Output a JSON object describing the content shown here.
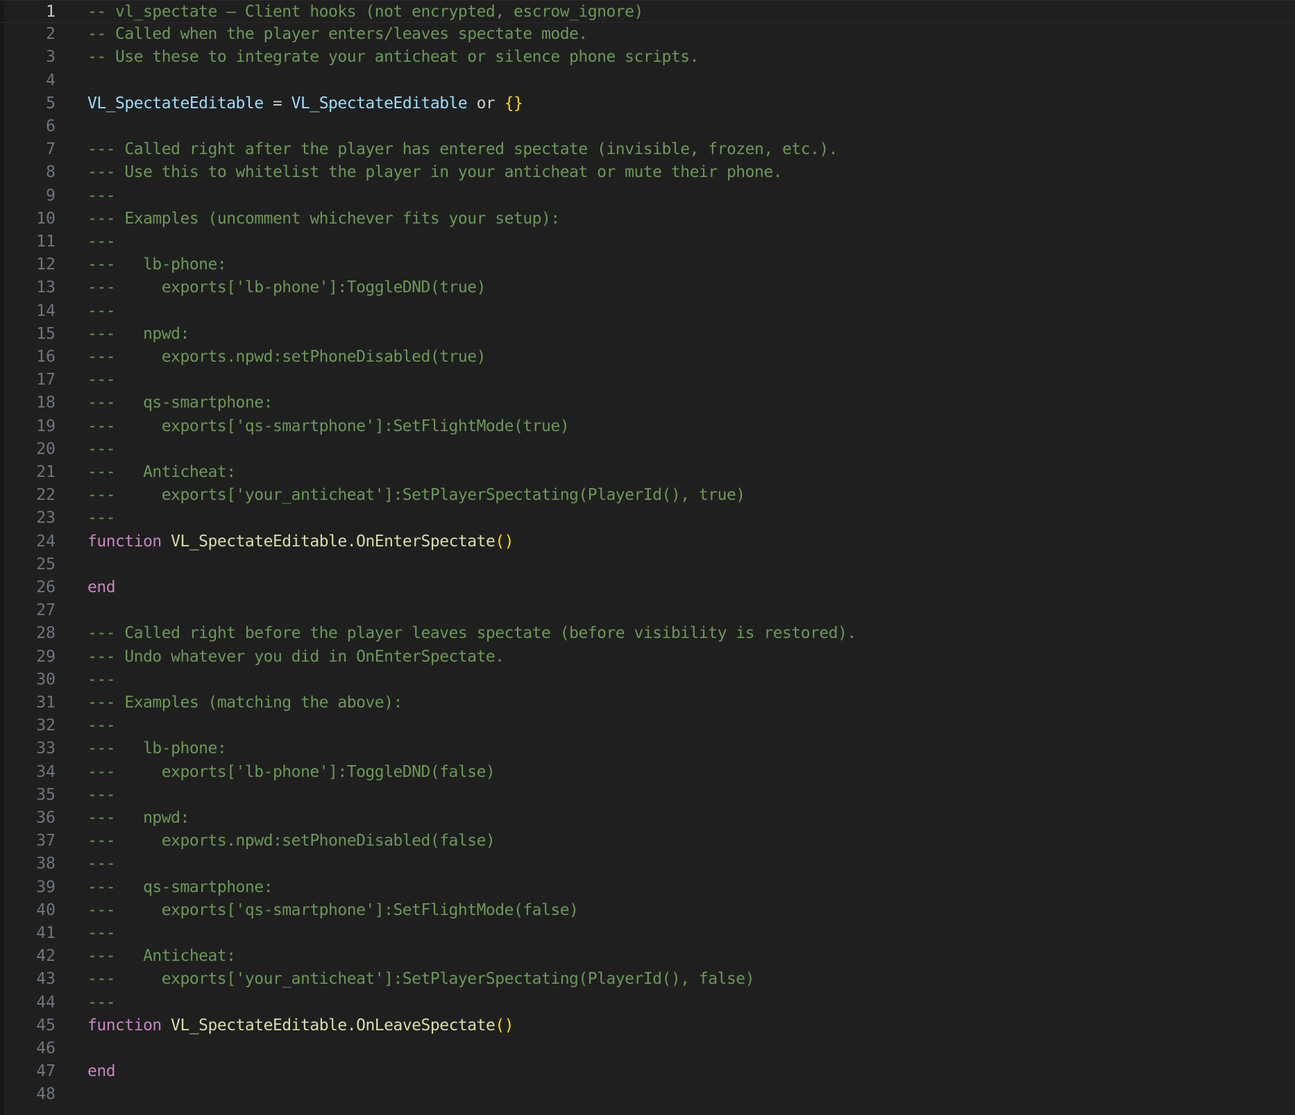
{
  "editor": {
    "language": "lua",
    "current_line": 1,
    "colors": {
      "background": "#1f1f1f",
      "line_number": "#6e7681",
      "line_number_active": "#cccccc",
      "comment": "#6a9955",
      "variable": "#9cdcfe",
      "keyword": "#c586c0",
      "function": "#dcdcaa",
      "brace": "#ffd700",
      "plain": "#cccccc"
    },
    "lines": [
      {
        "n": "1",
        "tokens": [
          {
            "t": "-- vl_spectate — Client hooks (not encrypted, escrow_ignore)",
            "c": "comment"
          }
        ]
      },
      {
        "n": "2",
        "tokens": [
          {
            "t": "-- Called when the player enters/leaves spectate mode.",
            "c": "comment"
          }
        ]
      },
      {
        "n": "3",
        "tokens": [
          {
            "t": "-- Use these to integrate your anticheat or silence phone scripts.",
            "c": "comment"
          }
        ]
      },
      {
        "n": "4",
        "tokens": []
      },
      {
        "n": "5",
        "tokens": [
          {
            "t": "VL_SpectateEditable",
            "c": "var"
          },
          {
            "t": " = ",
            "c": "plain"
          },
          {
            "t": "VL_SpectateEditable",
            "c": "var"
          },
          {
            "t": " ",
            "c": "plain"
          },
          {
            "t": "or",
            "c": "plain"
          },
          {
            "t": " ",
            "c": "plain"
          },
          {
            "t": "{}",
            "c": "brace"
          }
        ]
      },
      {
        "n": "6",
        "tokens": []
      },
      {
        "n": "7",
        "tokens": [
          {
            "t": "--- Called right after the player has entered spectate (invisible, frozen, etc.).",
            "c": "comment"
          }
        ]
      },
      {
        "n": "8",
        "tokens": [
          {
            "t": "--- Use this to whitelist the player in your anticheat or mute their phone.",
            "c": "comment"
          }
        ]
      },
      {
        "n": "9",
        "tokens": [
          {
            "t": "---",
            "c": "comment"
          }
        ]
      },
      {
        "n": "10",
        "tokens": [
          {
            "t": "--- Examples (uncomment whichever fits your setup):",
            "c": "comment"
          }
        ]
      },
      {
        "n": "11",
        "tokens": [
          {
            "t": "---",
            "c": "comment"
          }
        ]
      },
      {
        "n": "12",
        "tokens": [
          {
            "t": "---   lb-phone:",
            "c": "comment"
          }
        ]
      },
      {
        "n": "13",
        "tokens": [
          {
            "t": "---     exports['lb-phone']:ToggleDND(true)",
            "c": "comment"
          }
        ]
      },
      {
        "n": "14",
        "tokens": [
          {
            "t": "---",
            "c": "comment"
          }
        ]
      },
      {
        "n": "15",
        "tokens": [
          {
            "t": "---   npwd:",
            "c": "comment"
          }
        ]
      },
      {
        "n": "16",
        "tokens": [
          {
            "t": "---     exports.npwd:setPhoneDisabled(true)",
            "c": "comment"
          }
        ]
      },
      {
        "n": "17",
        "tokens": [
          {
            "t": "---",
            "c": "comment"
          }
        ]
      },
      {
        "n": "18",
        "tokens": [
          {
            "t": "---   qs-smartphone:",
            "c": "comment"
          }
        ]
      },
      {
        "n": "19",
        "tokens": [
          {
            "t": "---     exports['qs-smartphone']:SetFlightMode(true)",
            "c": "comment"
          }
        ]
      },
      {
        "n": "20",
        "tokens": [
          {
            "t": "---",
            "c": "comment"
          }
        ]
      },
      {
        "n": "21",
        "tokens": [
          {
            "t": "---   Anticheat:",
            "c": "comment"
          }
        ]
      },
      {
        "n": "22",
        "tokens": [
          {
            "t": "---     exports['your_anticheat']:SetPlayerSpectating(PlayerId(), true)",
            "c": "comment"
          }
        ]
      },
      {
        "n": "23",
        "tokens": [
          {
            "t": "---",
            "c": "comment"
          }
        ]
      },
      {
        "n": "24",
        "tokens": [
          {
            "t": "function",
            "c": "kw"
          },
          {
            "t": " ",
            "c": "plain"
          },
          {
            "t": "VL_SpectateEditable.",
            "c": "fn"
          },
          {
            "t": "OnEnterSpectate",
            "c": "fn"
          },
          {
            "t": "()",
            "c": "brace"
          }
        ]
      },
      {
        "n": "25",
        "tokens": []
      },
      {
        "n": "26",
        "tokens": [
          {
            "t": "end",
            "c": "kw"
          }
        ]
      },
      {
        "n": "27",
        "tokens": []
      },
      {
        "n": "28",
        "tokens": [
          {
            "t": "--- Called right before the player leaves spectate (before visibility is restored).",
            "c": "comment"
          }
        ]
      },
      {
        "n": "29",
        "tokens": [
          {
            "t": "--- Undo whatever you did in OnEnterSpectate.",
            "c": "comment"
          }
        ]
      },
      {
        "n": "30",
        "tokens": [
          {
            "t": "---",
            "c": "comment"
          }
        ]
      },
      {
        "n": "31",
        "tokens": [
          {
            "t": "--- Examples (matching the above):",
            "c": "comment"
          }
        ]
      },
      {
        "n": "32",
        "tokens": [
          {
            "t": "---",
            "c": "comment"
          }
        ]
      },
      {
        "n": "33",
        "tokens": [
          {
            "t": "---   lb-phone:",
            "c": "comment"
          }
        ]
      },
      {
        "n": "34",
        "tokens": [
          {
            "t": "---     exports['lb-phone']:ToggleDND(false)",
            "c": "comment"
          }
        ]
      },
      {
        "n": "35",
        "tokens": [
          {
            "t": "---",
            "c": "comment"
          }
        ]
      },
      {
        "n": "36",
        "tokens": [
          {
            "t": "---   npwd:",
            "c": "comment"
          }
        ]
      },
      {
        "n": "37",
        "tokens": [
          {
            "t": "---     exports.npwd:setPhoneDisabled(false)",
            "c": "comment"
          }
        ]
      },
      {
        "n": "38",
        "tokens": [
          {
            "t": "---",
            "c": "comment"
          }
        ]
      },
      {
        "n": "39",
        "tokens": [
          {
            "t": "---   qs-smartphone:",
            "c": "comment"
          }
        ]
      },
      {
        "n": "40",
        "tokens": [
          {
            "t": "---     exports['qs-smartphone']:SetFlightMode(false)",
            "c": "comment"
          }
        ]
      },
      {
        "n": "41",
        "tokens": [
          {
            "t": "---",
            "c": "comment"
          }
        ]
      },
      {
        "n": "42",
        "tokens": [
          {
            "t": "---   Anticheat:",
            "c": "comment"
          }
        ]
      },
      {
        "n": "43",
        "tokens": [
          {
            "t": "---     exports['your_anticheat']:SetPlayerSpectating(PlayerId(), false)",
            "c": "comment"
          }
        ]
      },
      {
        "n": "44",
        "tokens": [
          {
            "t": "---",
            "c": "comment"
          }
        ]
      },
      {
        "n": "45",
        "tokens": [
          {
            "t": "function",
            "c": "kw"
          },
          {
            "t": " ",
            "c": "plain"
          },
          {
            "t": "VL_SpectateEditable.",
            "c": "fn"
          },
          {
            "t": "OnLeaveSpectate",
            "c": "fn"
          },
          {
            "t": "()",
            "c": "brace"
          }
        ]
      },
      {
        "n": "46",
        "tokens": []
      },
      {
        "n": "47",
        "tokens": [
          {
            "t": "end",
            "c": "kw"
          }
        ]
      },
      {
        "n": "48",
        "tokens": []
      }
    ]
  }
}
